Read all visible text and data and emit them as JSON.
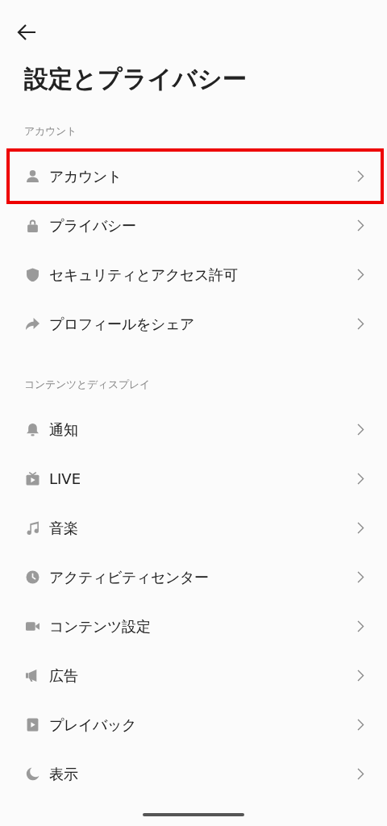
{
  "title": "設定とプライバシー",
  "sections": [
    {
      "label": "アカウント",
      "items": [
        {
          "label": "アカウント",
          "highlighted": true
        },
        {
          "label": "プライバシー",
          "highlighted": false
        },
        {
          "label": "セキュリティとアクセス許可",
          "highlighted": false
        },
        {
          "label": "プロフィールをシェア",
          "highlighted": false
        }
      ]
    },
    {
      "label": "コンテンツとディスプレイ",
      "items": [
        {
          "label": "通知",
          "highlighted": false
        },
        {
          "label": "LIVE",
          "highlighted": false
        },
        {
          "label": "音楽",
          "highlighted": false
        },
        {
          "label": "アクティビティセンター",
          "highlighted": false
        },
        {
          "label": "コンテンツ設定",
          "highlighted": false
        },
        {
          "label": "広告",
          "highlighted": false
        },
        {
          "label": "プレイバック",
          "highlighted": false
        },
        {
          "label": "表示",
          "highlighted": false
        }
      ]
    }
  ]
}
